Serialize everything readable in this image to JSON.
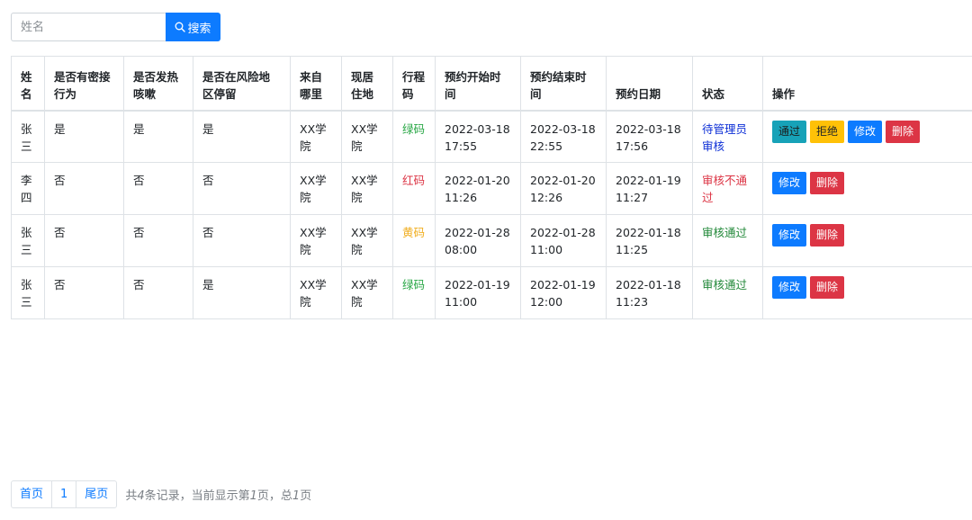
{
  "search": {
    "placeholder": "姓名",
    "button_label": "搜索",
    "icon": "search-icon"
  },
  "table": {
    "headers": {
      "name": "姓名",
      "close_contact": "是否有密接行为",
      "fever_cough": "是否发热咳嗽",
      "risk_area": "是否在风险地区停留",
      "from_where": "来自哪里",
      "residence": "现居住地",
      "travel_code": "行程码",
      "start_time": "预约开始时间",
      "end_time": "预约结束时间",
      "date": "预约日期",
      "status": "状态",
      "actions": "操作"
    },
    "rows": [
      {
        "name": "张三",
        "close_contact": "是",
        "fever_cough": "是",
        "risk_area": "是",
        "from_where": "XX学院",
        "residence": "XX学院",
        "travel_code": "绿码",
        "start_time": "2022-03-18 17:55",
        "end_time": "2022-03-18 22:55",
        "date": "2022-03-18 17:56",
        "status": "待管理员审核"
      },
      {
        "name": "李四",
        "close_contact": "否",
        "fever_cough": "否",
        "risk_area": "否",
        "from_where": "XX学院",
        "residence": "XX学院",
        "travel_code": "红码",
        "start_time": "2022-01-20 11:26",
        "end_time": "2022-01-20 12:26",
        "date": "2022-01-19 11:27",
        "status": "审核不通过"
      },
      {
        "name": "张三",
        "close_contact": "否",
        "fever_cough": "否",
        "risk_area": "否",
        "from_where": "XX学院",
        "residence": "XX学院",
        "travel_code": "黄码",
        "start_time": "2022-01-28 08:00",
        "end_time": "2022-01-28 11:00",
        "date": "2022-01-18 11:25",
        "status": "审核通过"
      },
      {
        "name": "张三",
        "close_contact": "否",
        "fever_cough": "否",
        "risk_area": "是",
        "from_where": "XX学院",
        "residence": "XX学院",
        "travel_code": "绿码",
        "start_time": "2022-01-19 11:00",
        "end_time": "2022-01-19 12:00",
        "date": "2022-01-18 11:23",
        "status": "审核通过"
      }
    ],
    "action_labels": {
      "approve": "通过",
      "reject": "拒绝",
      "edit": "修改",
      "delete": "删除"
    }
  },
  "colors": {
    "primary": "#0d7bff",
    "info": "#17a2b8",
    "warning": "#ffc107",
    "danger": "#dc3545",
    "green_code": "#28a745",
    "red_code": "#dc3545",
    "yellow_code": "#f0ad1e",
    "status_pending": "#0d2fd6",
    "status_rejected": "#dc3545",
    "status_approved": "#218838"
  },
  "pagination": {
    "first": "首页",
    "page": "1",
    "last": "尾页",
    "info_prefix": "共",
    "total_records": "4",
    "info_mid": "条记录，当前显示第",
    "current_page": "1",
    "info_mid2": "页，总",
    "total_pages": "1",
    "info_suffix": "页"
  }
}
